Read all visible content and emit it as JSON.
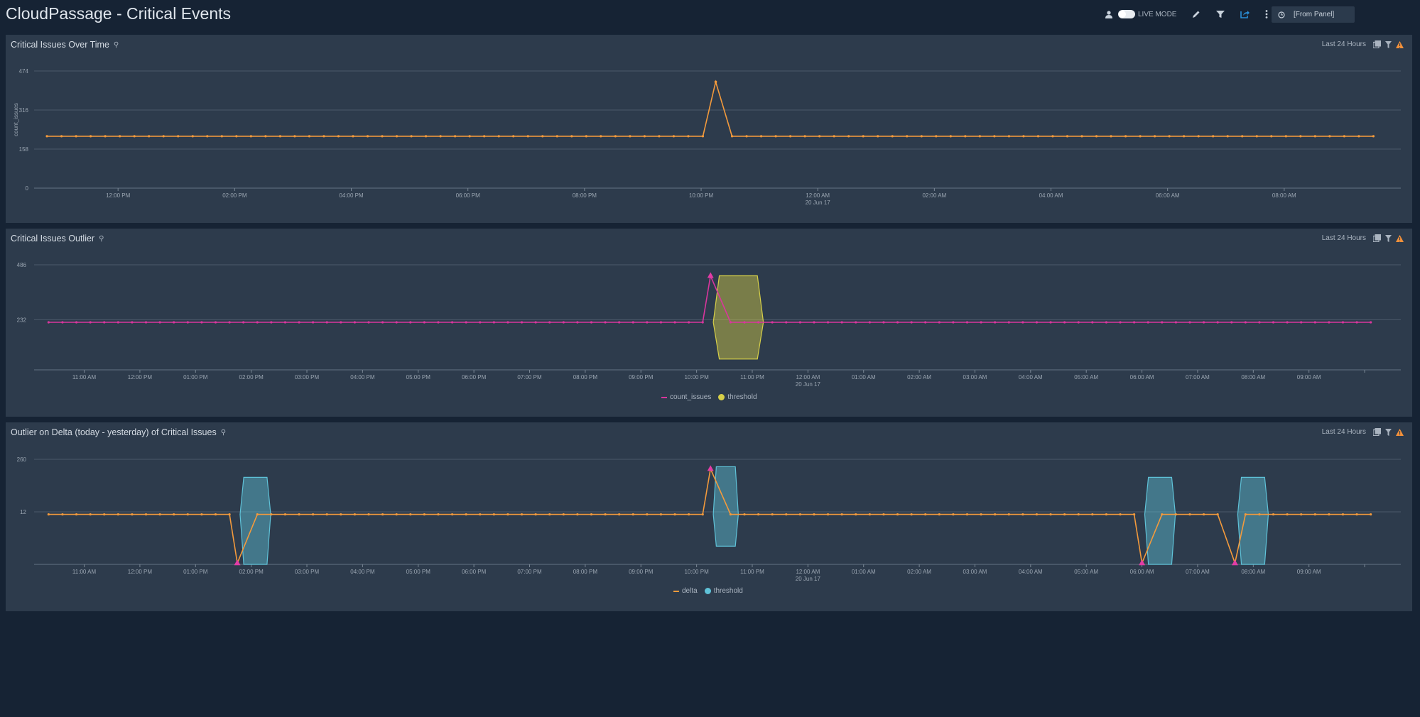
{
  "header": {
    "title": "CloudPassage - Critical Events",
    "live_mode_label": "LIVE MODE",
    "time_picker_value": "[From Panel]",
    "icons": [
      "user-icon",
      "live-mode-toggle",
      "edit-pencil-icon",
      "filter-icon",
      "share-icon",
      "more-vertical-icon",
      "clock-icon"
    ]
  },
  "colors": {
    "page_bg": "#162334",
    "panel_bg": "#2d3b4c",
    "orange": "#f39a3c",
    "magenta": "#d9369d",
    "threshold_yellow": "#d6cf48",
    "threshold_cyan": "#5fc2d8",
    "warning": "#f3913a",
    "accent_blue": "#2a8fd8"
  },
  "panels": [
    {
      "title": "Critical Issues Over Time",
      "time_range": "Last 24 Hours"
    },
    {
      "title": "Critical Issues Outlier",
      "time_range": "Last 24 Hours"
    },
    {
      "title": "Outlier on Delta (today - yesterday) of Critical Issues",
      "time_range": "Last 24 Hours"
    }
  ],
  "chart_data": [
    {
      "type": "line",
      "title": "Critical Issues Over Time",
      "xlabel": "",
      "ylabel": "count_issues",
      "y_ticks": [
        "0",
        "158",
        "316",
        "474"
      ],
      "ylim": [
        0,
        474
      ],
      "x_ticks": [
        "12:00 PM",
        "02:00 PM",
        "04:00 PM",
        "06:00 PM",
        "08:00 PM",
        "10:00 PM",
        "12:00 AM",
        "02:00 AM",
        "04:00 AM",
        "06:00 AM",
        "08:00 AM"
      ],
      "x_subticks": {
        "12:00 AM": "20 Jun 17"
      },
      "x_range_hours": [
        10.56,
        34.0
      ],
      "tick_start_hour": 12,
      "tick_step_hours": 2,
      "grid": true,
      "legend": "none",
      "series": [
        {
          "name": "count_issues",
          "color": "#f39a3c",
          "baseline": 210,
          "start_hour": 10.78,
          "end_hour": 33.75,
          "step_hours": 0.25,
          "spikes": [
            {
              "hour": 22.25,
              "value": 430
            }
          ]
        }
      ]
    },
    {
      "type": "line",
      "title": "Critical Issues Outlier",
      "ylabel": "",
      "y_ticks": [
        "232",
        "486"
      ],
      "ylim": [
        0,
        486
      ],
      "x_ticks": [
        "11:00 AM",
        "12:00 PM",
        "01:00 PM",
        "02:00 PM",
        "03:00 PM",
        "04:00 PM",
        "05:00 PM",
        "06:00 PM",
        "07:00 PM",
        "08:00 PM",
        "09:00 PM",
        "10:00 PM",
        "11:00 PM",
        "12:00 AM",
        "01:00 AM",
        "02:00 AM",
        "03:00 AM",
        "04:00 AM",
        "05:00 AM",
        "06:00 AM",
        "07:00 AM",
        "08:00 AM",
        "09:00 AM"
      ],
      "x_subticks": {
        "12:00 AM": "20 Jun 17"
      },
      "x_range_hours": [
        10.1,
        34.65
      ],
      "tick_start_hour": 11,
      "tick_step_hours": 1,
      "grid": true,
      "legend": "bottom-center",
      "series": [
        {
          "name": "count_issues",
          "color": "#d9369d",
          "baseline": 220,
          "start_hour": 10.36,
          "end_hour": 34.3,
          "step_hours": 0.25,
          "spikes": [
            {
              "hour": 22.25,
              "value": 435,
              "marker": "triangle"
            }
          ]
        },
        {
          "name": "threshold",
          "color": "#d6cf48",
          "bands": [
            {
              "start_hour": 22.3,
              "end_hour": 23.2,
              "lower": 50,
              "upper": 435
            }
          ]
        }
      ]
    },
    {
      "type": "line",
      "title": "Outlier on Delta (today - yesterday) of Critical Issues",
      "ylabel": "",
      "y_ticks": [
        "12",
        "260"
      ],
      "ylim": [
        -236,
        260
      ],
      "x_ticks": [
        "11:00 AM",
        "12:00 PM",
        "01:00 PM",
        "02:00 PM",
        "03:00 PM",
        "04:00 PM",
        "05:00 PM",
        "06:00 PM",
        "07:00 PM",
        "08:00 PM",
        "09:00 PM",
        "10:00 PM",
        "11:00 PM",
        "12:00 AM",
        "01:00 AM",
        "02:00 AM",
        "03:00 AM",
        "04:00 AM",
        "05:00 AM",
        "06:00 AM",
        "07:00 AM",
        "08:00 AM",
        "09:00 AM"
      ],
      "x_subticks": {
        "12:00 AM": "20 Jun 17"
      },
      "x_range_hours": [
        10.1,
        34.65
      ],
      "tick_start_hour": 11,
      "tick_step_hours": 1,
      "grid": true,
      "legend": "bottom-center",
      "series": [
        {
          "name": "delta",
          "color": "#f39a3c",
          "baseline": 0,
          "start_hour": 10.36,
          "end_hour": 34.3,
          "step_hours": 0.25,
          "spikes": [
            {
              "hour": 13.75,
              "value": -230,
              "marker": "triangle"
            },
            {
              "hour": 22.25,
              "value": 215,
              "marker": "triangle"
            },
            {
              "hour": 30.0,
              "value": -230,
              "marker": "triangle"
            },
            {
              "hour": 31.67,
              "value": -230,
              "marker": "triangle"
            }
          ]
        },
        {
          "name": "threshold",
          "color": "#5fc2d8",
          "bands": [
            {
              "start_hour": 13.8,
              "end_hour": 14.35,
              "lower": -236,
              "upper": 175
            },
            {
              "start_hour": 22.3,
              "end_hour": 22.75,
              "lower": -150,
              "upper": 225
            },
            {
              "start_hour": 30.05,
              "end_hour": 30.6,
              "lower": -236,
              "upper": 175
            },
            {
              "start_hour": 31.72,
              "end_hour": 32.27,
              "lower": -236,
              "upper": 175
            }
          ]
        }
      ]
    }
  ]
}
